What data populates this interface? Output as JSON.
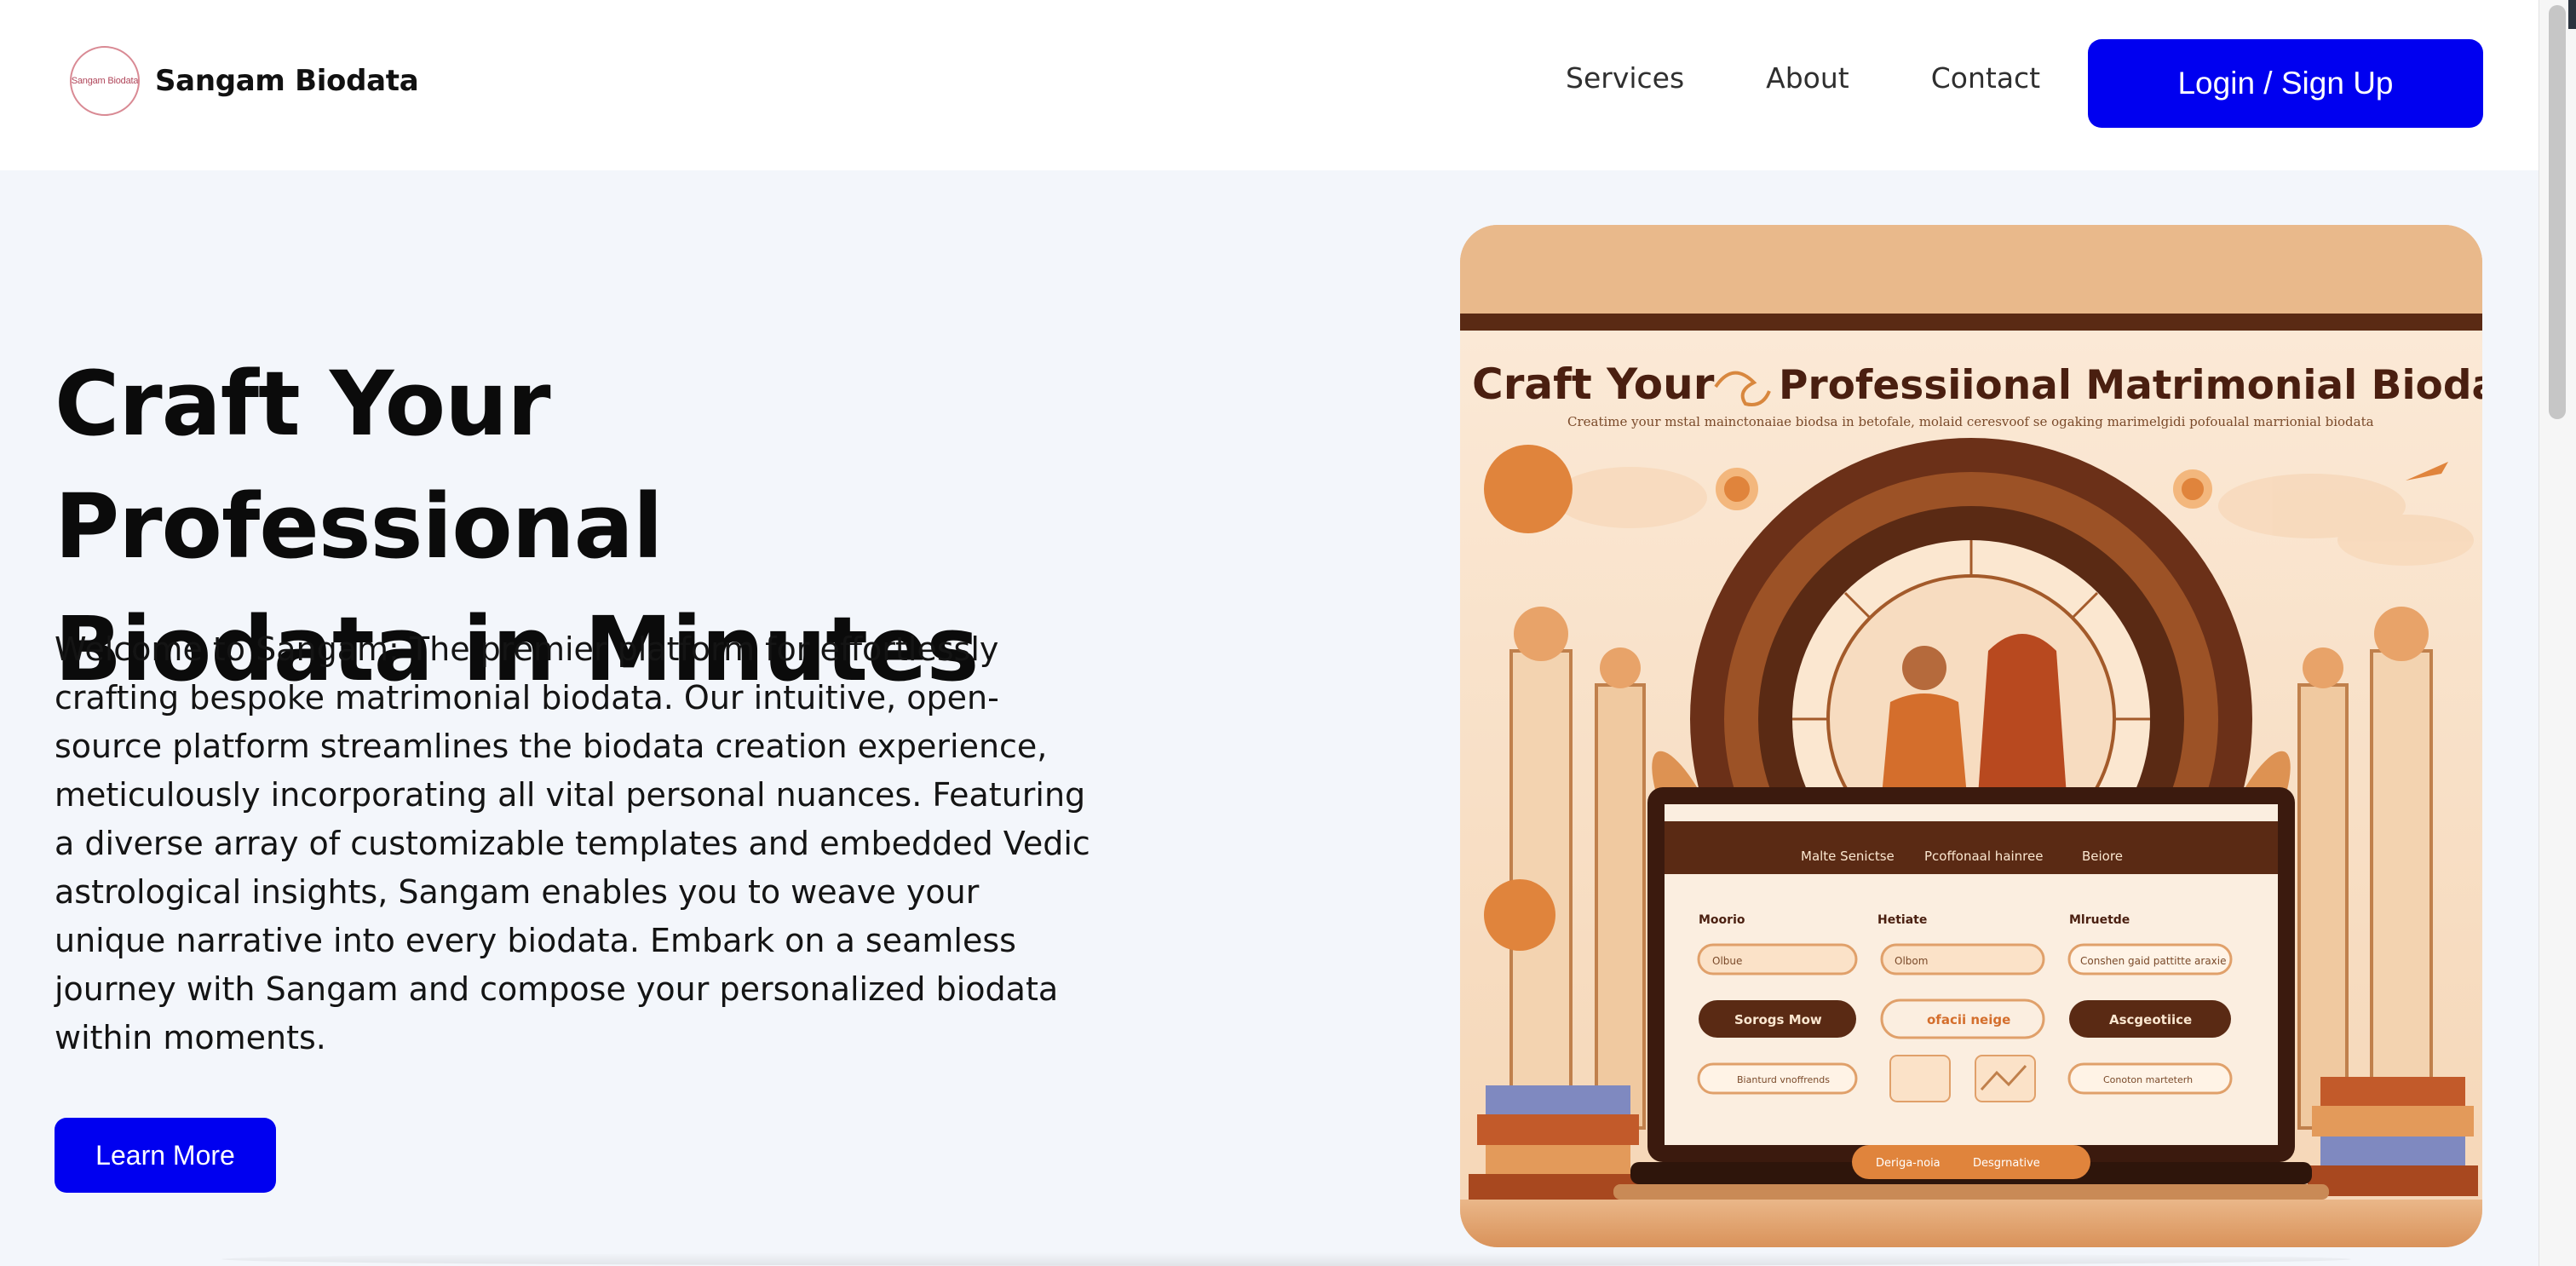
{
  "brand": {
    "logo_text": "Sangam Biodata",
    "name": "Sangam Biodata"
  },
  "nav": {
    "links": [
      "Services",
      "About",
      "Contact"
    ],
    "login_label": "Login / Sign Up"
  },
  "hero": {
    "title_line1": "Craft Your Professional",
    "title_line2": "Biodata in Minutes",
    "description": "Welcome to Sangam: The premier platform for effortlessly crafting bespoke matrimonial biodata. Our intuitive, open-source platform streamlines the biodata creation experience, meticulously incorporating all vital personal nuances. Featuring a diverse array of customizable templates and embedded Vedic astrological insights, Sangam enables you to weave your unique narrative into every biodata. Embark on a seamless journey with Sangam and compose your personalized biodata within moments.",
    "learn_more_label": "Learn More"
  },
  "illustration": {
    "heading_left": "Craft Your",
    "heading_right": "Professiional Matrimonial Biodata",
    "subheading": "Creatime your mstal mainctonaiae biodsa in betofale, molaid ceresvoof se ogaking marimelgidi pofoualal marrionial biodata",
    "tabs": [
      "Malte Senictse",
      "Pcoffonaal hainree",
      "Beiore"
    ],
    "field_labels": [
      "Moorio",
      "Hetiate",
      "Mlruetde"
    ],
    "field_values": [
      "Olbue",
      "Olbom",
      "Conshen gaid pattitte araxie"
    ],
    "buttons": [
      "Sorogs Mow",
      "ofacii neige",
      "Ascgeotiice"
    ],
    "bottom_items": [
      "Bianturd vnoffrends",
      "Conoton marteterh"
    ],
    "footer_pill": [
      "Deriga-noia",
      "Desgrnative"
    ],
    "colors": {
      "primary_button": "#0000f0",
      "illustration_bg": "#f3d2b0",
      "illustration_brown": "#5a2a14",
      "illustration_orange": "#e0843c"
    }
  }
}
